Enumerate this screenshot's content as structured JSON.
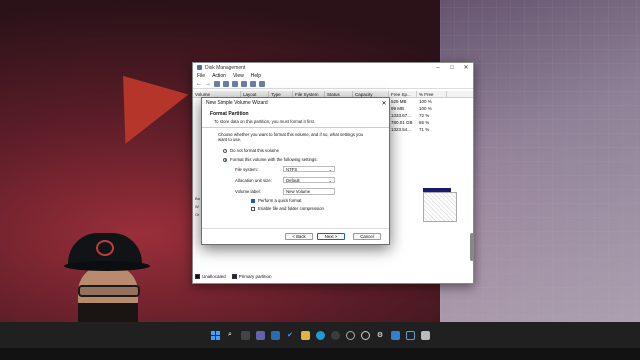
{
  "disk_management": {
    "title": "Disk Management",
    "menu": [
      "File",
      "Action",
      "View",
      "Help"
    ],
    "columns": [
      "Volume",
      "Layout",
      "Type",
      "File System",
      "Status",
      "Capacity",
      "Free Sp...",
      "% Free"
    ],
    "rows": [
      {
        "free": "529 MB",
        "pct": "100 %"
      },
      {
        "free": "99 MB",
        "pct": "100 %"
      },
      {
        "free": "1333.67...",
        "pct": "72 %"
      },
      {
        "free": "780.01 GB",
        "pct": "85 %"
      },
      {
        "free": "1323.54...",
        "pct": "71 %"
      }
    ],
    "disk_labels": [
      "Ba",
      "W",
      "Or"
    ],
    "legend": {
      "unallocated": "Unallocated",
      "primary": "Primary partition"
    },
    "colors": {
      "unallocated": "#111111",
      "primary": "#1a1a8e"
    }
  },
  "wizard": {
    "title": "New Simple Volume Wizard",
    "heading": "Format Partition",
    "subheading": "To store data on this partition, you must format it first.",
    "prompt": "Choose whether you want to format this volume, and if so, what settings you want to use.",
    "option_no_format": "Do not format this volume",
    "option_format": "Format this volume with the following settings:",
    "file_system_label": "File system:",
    "file_system_value": "NTFS",
    "alloc_label": "Allocation unit size:",
    "alloc_value": "Default",
    "volume_label_label": "Volume label:",
    "volume_label_value": "New Volume",
    "quick_format": "Perform a quick format",
    "compression": "Enable file and folder compression",
    "back": "< Back",
    "next": "Next >",
    "cancel": "Cancel"
  }
}
